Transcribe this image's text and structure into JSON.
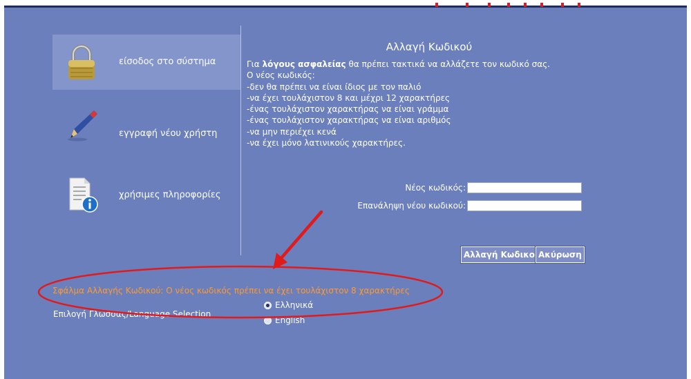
{
  "nav": {
    "items": [
      {
        "label": "είσοδος στο σύστημα",
        "icon": "padlock-icon",
        "active": true
      },
      {
        "label": "εγγραφή νέου χρήστη",
        "icon": "pencil-icon",
        "active": false
      },
      {
        "label": "χρήσιμες πληροφορίες",
        "icon": "document-info-icon",
        "active": false
      }
    ]
  },
  "form": {
    "title": "Αλλαγή Κωδικού",
    "intro_prefix": "Για",
    "intro_bold": "λόγους ασφαλείας",
    "intro_suffix": "θα πρέπει τακτικά να αλλάζετε τον κωδικό σας.",
    "rules": [
      "Ο νέος κωδικός:",
      "-δεν θα πρέπει να είναι ίδιος με τον παλιό",
      "-να έχει τουλάχιστον 8 και μέχρι 12 χαρακτήρες",
      "-ένας τουλάχιστον χαρακτήρας να είναι γράμμα",
      "-ένας τουλάχιστον χαρακτήρας να είναι αριθμός",
      "-να μην περιέχει κενά",
      "-να έχει μόνο λατινικούς χαρακτήρες."
    ],
    "new_password_label": "Νέος κωδικός:",
    "new_password_value": "",
    "repeat_password_label": "Επανάληψη νέου κωδικού:",
    "repeat_password_value": "",
    "change_button": "Αλλαγή Κωδικού",
    "cancel_button": "Ακύρωση"
  },
  "error_message": "Σφάλμα Αλλαγής Κωδικού: Ο νέος κωδικός πρέπει να έχει τουλάχιστον 8 χαρακτήρες",
  "language": {
    "label": "Επιλογή Γλώσσας/Language Selection",
    "options": [
      {
        "label": "Ελληνικά",
        "selected": true
      },
      {
        "label": "English",
        "selected": false
      }
    ]
  },
  "colors": {
    "panel": "#6b7fbd",
    "active_nav": "#8495cb",
    "error_text": "#ff9a2a",
    "annotation": "#e01b1b"
  }
}
